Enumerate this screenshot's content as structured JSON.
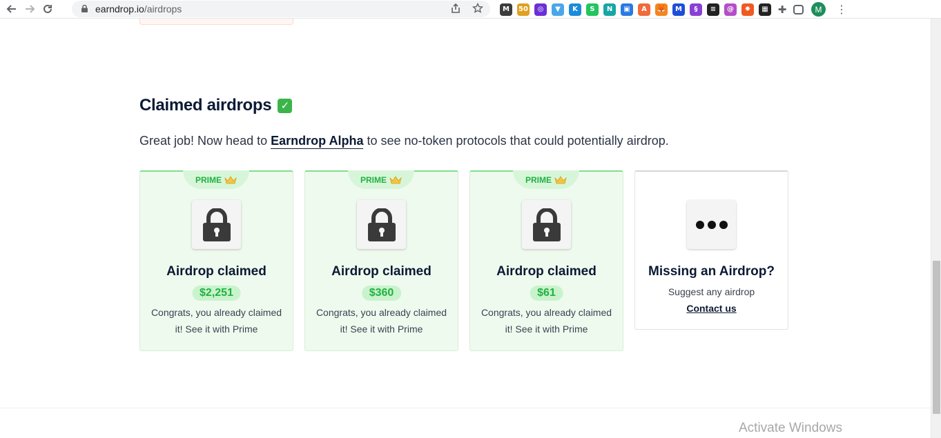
{
  "browser": {
    "url_host": "earndrop.io",
    "url_path": "/airdrops",
    "profile_initial": "M",
    "extensions": [
      {
        "name": "m-extension-icon",
        "label": "M",
        "color": "#3c3c3c"
      },
      {
        "name": "gitcoin-extension-icon",
        "label": "50",
        "color": "#e0a020"
      },
      {
        "name": "purple-ring-extension-icon",
        "label": "◎",
        "color": "#6b2fd6"
      },
      {
        "name": "plug-extension-icon",
        "label": "▼",
        "color": "#4aa6e8"
      },
      {
        "name": "k-extension-icon",
        "label": "K",
        "color": "#1a8cdb"
      },
      {
        "name": "green-s-extension-icon",
        "label": "S",
        "color": "#22c55e"
      },
      {
        "name": "n-extension-icon",
        "label": "N",
        "color": "#18a5a5"
      },
      {
        "name": "blue-square-extension-icon",
        "label": "▣",
        "color": "#2a7ae2"
      },
      {
        "name": "avalanche-extension-icon",
        "label": "A",
        "color": "#f06a3a"
      },
      {
        "name": "metamask-extension-icon",
        "label": "🦊",
        "color": "#f6851b"
      },
      {
        "name": "m-blue-extension-icon",
        "label": "M",
        "color": "#1d4ed8"
      },
      {
        "name": "s-purple-extension-icon",
        "label": "§",
        "color": "#8b3fd6"
      },
      {
        "name": "lines-extension-icon",
        "label": "≡",
        "color": "#222222"
      },
      {
        "name": "circle-a-extension-icon",
        "label": "@",
        "color": "#b44fc8"
      },
      {
        "name": "star-extension-icon",
        "label": "✸",
        "color": "#f05a22"
      },
      {
        "name": "grid-extension-icon",
        "label": "▦",
        "color": "#222222"
      }
    ]
  },
  "section": {
    "title": "Claimed airdrops",
    "intro_before": "Great job! Now head to ",
    "intro_link": "Earndrop Alpha",
    "intro_after": " to see no-token protocols that could potentially airdrop."
  },
  "cards": [
    {
      "badge": "PRIME",
      "title": "Airdrop claimed",
      "amount": "$2,251",
      "text": "Congrats, you already claimed it! See it with Prime"
    },
    {
      "badge": "PRIME",
      "title": "Airdrop claimed",
      "amount": "$360",
      "text": "Congrats, you already claimed it! See it with Prime"
    },
    {
      "badge": "PRIME",
      "title": "Airdrop claimed",
      "amount": "$61",
      "text": "Congrats, you already claimed it! See it with Prime"
    }
  ],
  "missing_card": {
    "title": "Missing an Airdrop?",
    "text": "Suggest any airdrop",
    "link": "Contact us"
  },
  "watermark": "Activate Windows",
  "colors": {
    "prime_green": "#22b043",
    "card_bg": "#effaef",
    "heading": "#0b1a33"
  }
}
